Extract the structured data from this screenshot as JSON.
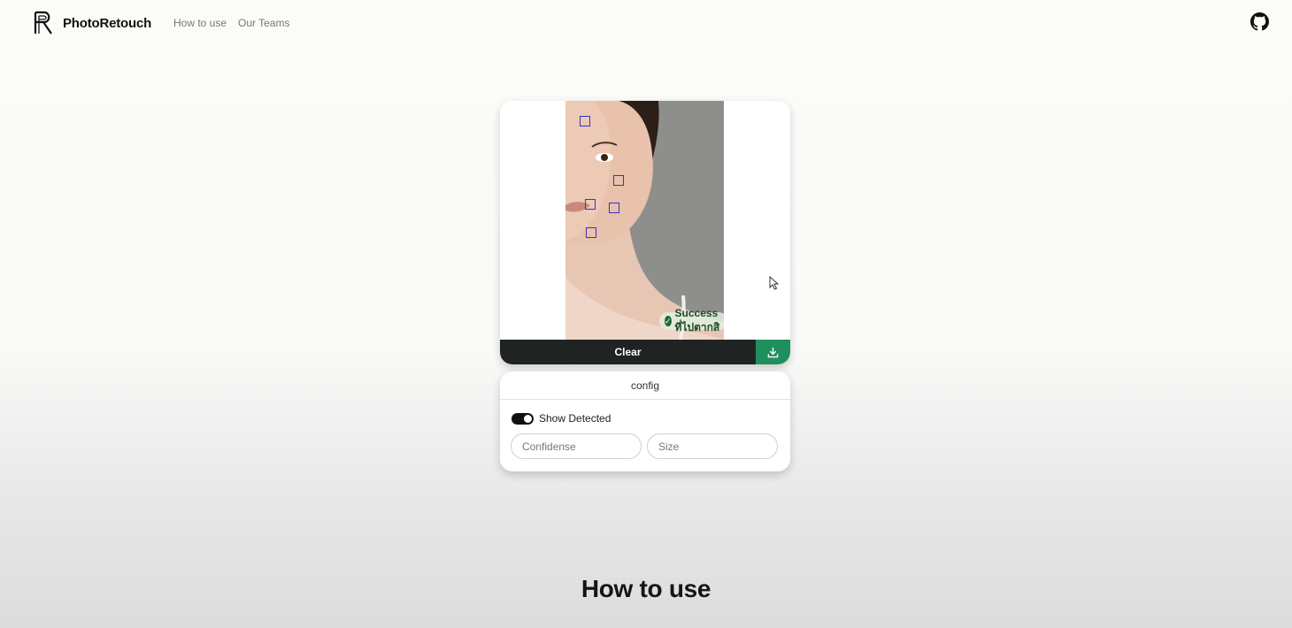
{
  "navbar": {
    "brand": "PhotoRetouch",
    "links": [
      "How to use",
      "Our Teams"
    ],
    "github_icon": "github-icon"
  },
  "result": {
    "status_text": "Success ที่ไปตากสิ",
    "status_icon": "check-circle-icon",
    "clear_label": "Clear",
    "download_icon": "download-icon",
    "accent_color": "#1f8f5d",
    "box_color": "#3a2fd1"
  },
  "config": {
    "title": "config",
    "show_detected_label": "Show Detected",
    "show_detected_on": true,
    "confidence_placeholder": "Confidense",
    "size_placeholder": "Size"
  },
  "section": {
    "title": "How to use"
  }
}
